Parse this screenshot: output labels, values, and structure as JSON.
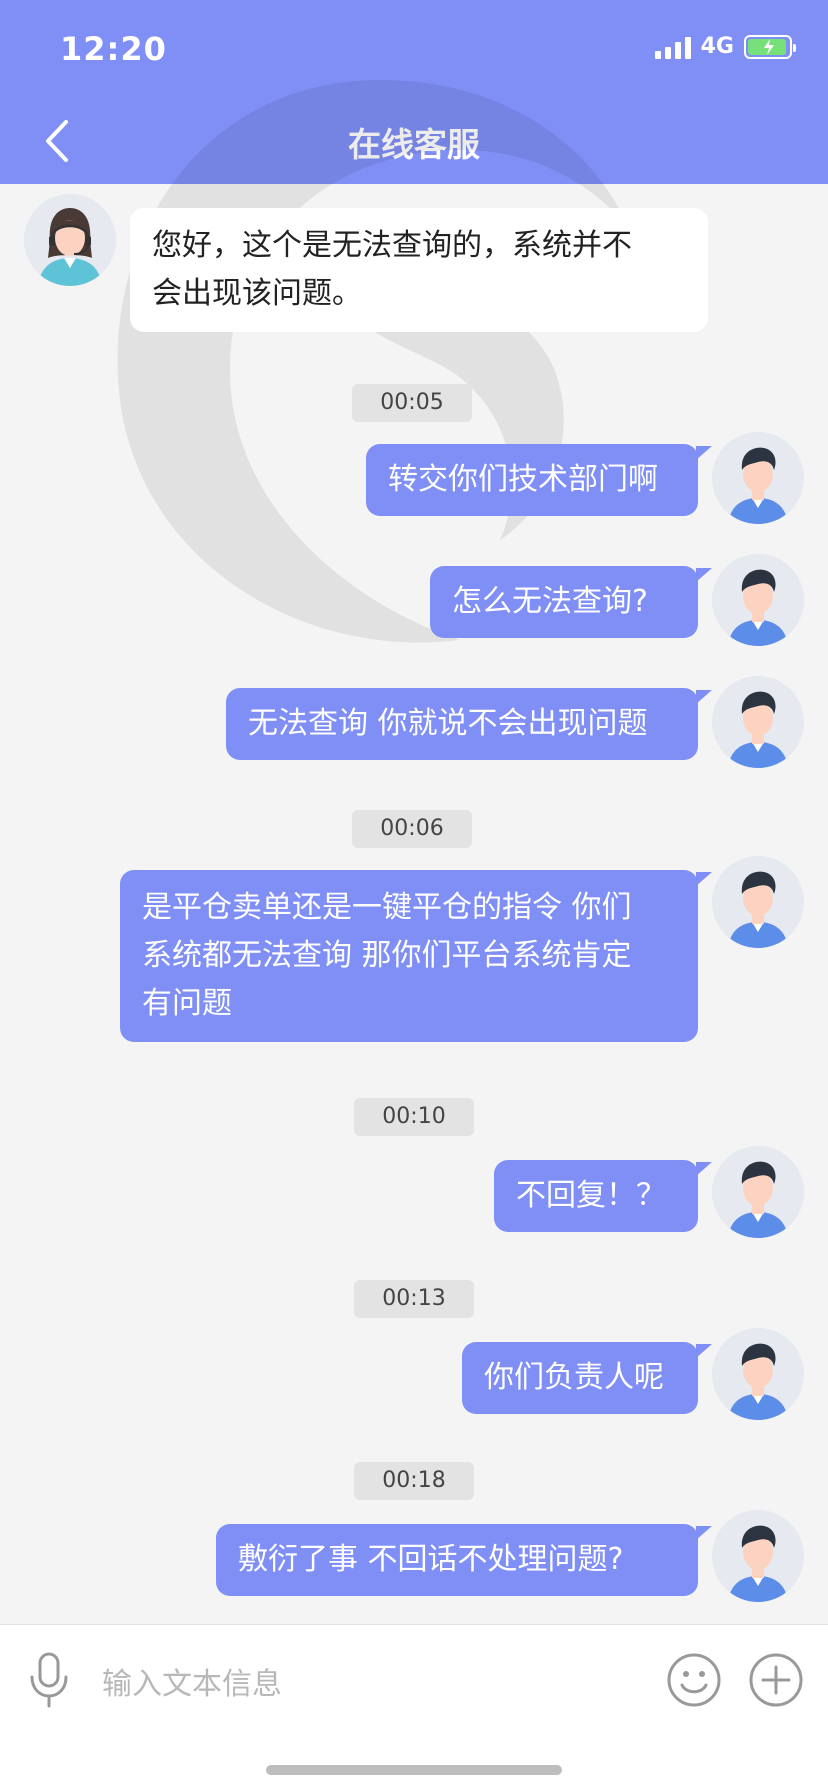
{
  "status": {
    "time": "12:20",
    "network": "4G"
  },
  "header": {
    "title": "在线客服"
  },
  "messages": {
    "m0": {
      "sender": "agent",
      "lines": [
        "您好，这个是无法查询的，系统并不",
        "会出现该问题。"
      ]
    },
    "t1": "00:05",
    "m1": "转交你们技术部门啊",
    "m2": "怎么无法查询?",
    "m3": "无法查询 你就说不会出现问题",
    "t2": "00:06",
    "m4": {
      "lines": [
        "是平仓卖单还是一键平仓的指令 你们",
        "系统都无法查询  那你们平台系统肯定",
        "有问题"
      ]
    },
    "t3": "00:10",
    "m5": "不回复！？",
    "t4": "00:13",
    "m6": "你们负责人呢",
    "t5": "00:18",
    "m7": "敷衍了事  不回话不处理问题?"
  },
  "input": {
    "placeholder": "输入文本信息"
  },
  "colors": {
    "accent": "#7f8ff5",
    "background": "#f4f4f4"
  }
}
